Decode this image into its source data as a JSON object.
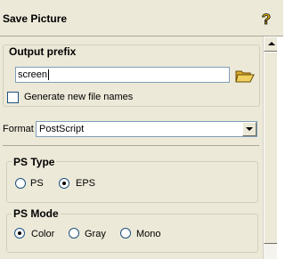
{
  "window": {
    "title": "Save Picture",
    "help_icon": "question-mark-icon"
  },
  "output_prefix": {
    "group_label": "Output prefix",
    "value": "screen",
    "browse_icon": "folder-open-icon",
    "generate_names_label": "Generate new file names",
    "generate_names_checked": false
  },
  "format": {
    "label": "Format",
    "selected": "PostScript"
  },
  "ps_type": {
    "group_label": "PS Type",
    "options": [
      {
        "label": "PS",
        "selected": false
      },
      {
        "label": "EPS",
        "selected": true
      }
    ]
  },
  "ps_mode": {
    "group_label": "PS Mode",
    "options": [
      {
        "label": "Color",
        "selected": true
      },
      {
        "label": "Gray",
        "selected": false
      },
      {
        "label": "Mono",
        "selected": false
      }
    ]
  },
  "colors": {
    "panel_bg": "#ece9d8",
    "input_border": "#7f9db9",
    "help_icon": "#f0c000",
    "folder_icon": "#e8c040"
  }
}
